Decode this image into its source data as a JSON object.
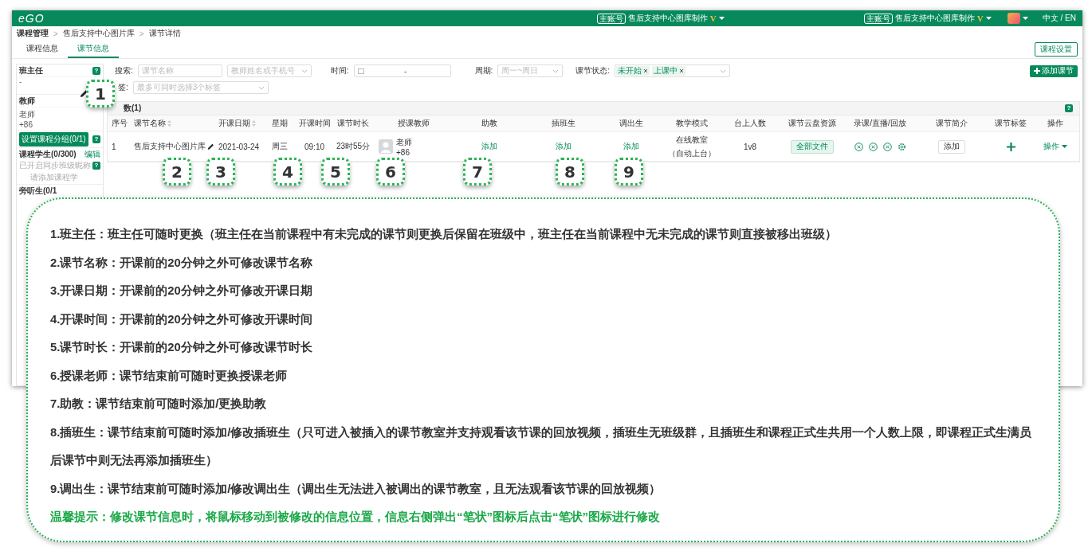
{
  "topbar": {
    "logo": "eGO",
    "accounts": [
      {
        "badge": "主账号",
        "name": "售后支持中心图库制作",
        "vip": "V"
      },
      {
        "badge": "主账号",
        "name": "售后支持中心图库制作",
        "vip": "V"
      }
    ],
    "language": "中文 / EN"
  },
  "breadcrumb": {
    "separator": ">",
    "items": [
      "课程管理",
      "售后支持中心图片库",
      "课节详情"
    ]
  },
  "tabs": [
    {
      "label": "课程信息",
      "selected": false
    },
    {
      "label": "课节信息",
      "selected": true
    }
  ],
  "settings_button": "课程设置",
  "sidebar": {
    "head_teacher": {
      "title": "班主任",
      "help": "?",
      "value": "-"
    },
    "teacher": {
      "title": "教师",
      "name": "老师",
      "phone": "+86"
    },
    "group_button": "设置课程分组(0/1)",
    "group_help": "?",
    "students": {
      "title": "课程学生(0/300)",
      "edit": "编辑",
      "sync_label": "已开启同步班级昵称",
      "sync_help": "?",
      "placeholder": "请添加课程学"
    },
    "auditors": {
      "title": "旁听生(0/1"
    }
  },
  "filters": {
    "search_label": "搜索:",
    "name_placeholder": "课节名称",
    "teacher_placeholder": "教师姓名或手机号",
    "time_label": "时间:",
    "time_separator": "-",
    "period_label": "周期:",
    "period_placeholder": "周一~周日",
    "status_label": "课节状态:",
    "status_tags": [
      "未开始",
      "上课中"
    ],
    "tag_label": "签:",
    "tag_placeholder": "最多可同时选择3个标签"
  },
  "add_button": "添加课节",
  "table": {
    "title": "数(1)",
    "help": "?",
    "columns": [
      {
        "label": "序号",
        "sortable": false
      },
      {
        "label": "课节名称",
        "sortable": true
      },
      {
        "label": "开课日期",
        "sortable": true
      },
      {
        "label": "星期",
        "sortable": false
      },
      {
        "label": "开课时间",
        "sortable": false
      },
      {
        "label": "课节时长",
        "sortable": false
      },
      {
        "label": "授课教师",
        "sortable": false
      },
      {
        "label": "助教",
        "sortable": false
      },
      {
        "label": "插班生",
        "sortable": false
      },
      {
        "label": "调出生",
        "sortable": false
      },
      {
        "label": "教学模式",
        "sortable": false
      },
      {
        "label": "台上人数",
        "sortable": false
      },
      {
        "label": "课节云盘资源",
        "sortable": false
      },
      {
        "label": "录课/直播/回放",
        "sortable": false
      },
      {
        "label": "课节简介",
        "sortable": false
      },
      {
        "label": "课节标签",
        "sortable": false
      },
      {
        "label": "操作",
        "sortable": false
      }
    ],
    "rows": [
      {
        "index": "1",
        "name": "售后支持中心图片库",
        "date": "2021-03-24",
        "weekday": "周三",
        "start": "09:10",
        "duration": "23时55分",
        "teacher_name": "老师",
        "teacher_phone": "+86",
        "assistant": "添加",
        "transfer_in": "添加",
        "transfer_out": "添加",
        "mode": "在线教室",
        "mode_note": "（自动上台）",
        "stage": "1v8",
        "files": "全部文件",
        "intro": "添加",
        "action": "操作"
      }
    ]
  },
  "callouts": [
    "1",
    "2",
    "3",
    "4",
    "5",
    "6",
    "7",
    "8",
    "9"
  ],
  "notes": [
    "1.班主任：班主任可随时更换（班主任在当前课程中有未完成的课节则更换后保留在班级中，班主任在当前课程中无未完成的课节则直接被移出班级）",
    "2.课节名称：开课前的20分钟之外可修改课节名称",
    "3.开课日期：开课前的20分钟之外可修改开课日期",
    "4.开课时间：开课前的20分钟之外可修改开课时间",
    "5.课节时长：开课前的20分钟之外可修改课节时长",
    "6.授课老师：课节结束前可随时更换授课老师",
    "7.助教：课节结束前可随时添加/更换助教",
    "8.插班生：课节结束前可随时添加/修改插班生（只可进入被插入的课节教室并支持观看该节课的回放视频，插班生无班级群，且插班生和课程正式生共用一个人数上限，即课程正式生满员后课节中则无法再添加插班生）",
    "9.调出生：课节结束前可随时添加/修改调出生（调出生无法进入被调出的课节教室，且无法观看该节课的回放视频）"
  ],
  "tip": "温馨提示：修改课节信息时，将鼠标移动到被修改的信息位置，信息右侧弹出“笔状”图标后点击“笔状”图标进行修改"
}
